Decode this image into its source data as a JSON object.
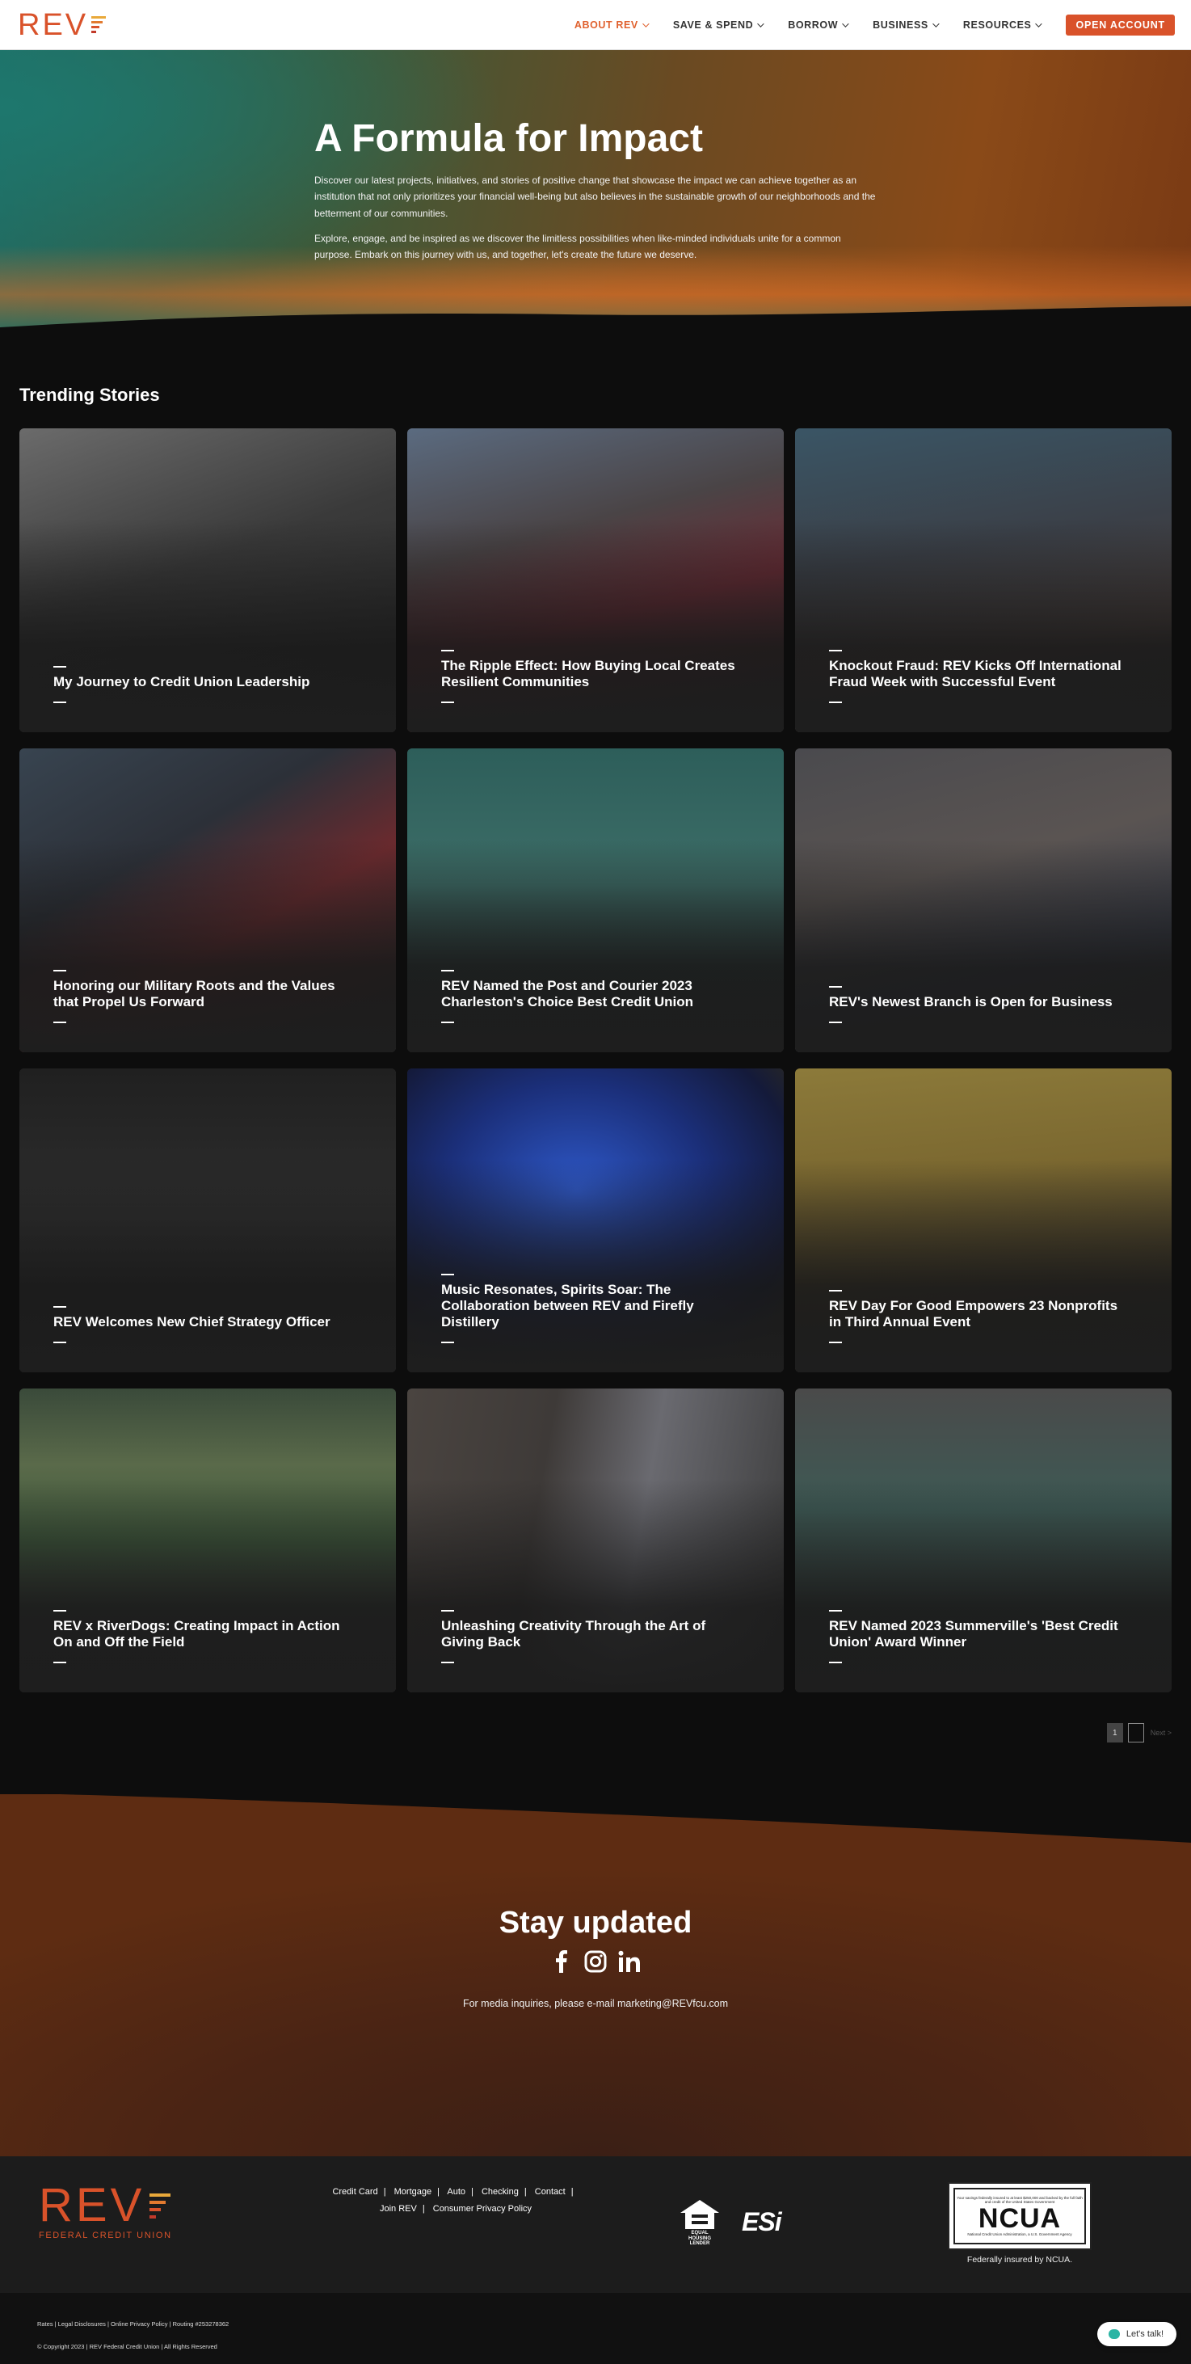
{
  "header": {
    "logo_text": "REV",
    "logo_colors": [
      "#e9a93a",
      "#e27a2f",
      "#d9522a",
      "#c23a2a"
    ],
    "nav": [
      {
        "label": "ABOUT REV",
        "active": true
      },
      {
        "label": "SAVE & SPEND",
        "active": false
      },
      {
        "label": "BORROW",
        "active": false
      },
      {
        "label": "BUSINESS",
        "active": false
      },
      {
        "label": "RESOURCES",
        "active": false
      }
    ],
    "cta": "OPEN ACCOUNT",
    "accent": "#d9522a"
  },
  "hero": {
    "title": "A Formula for Impact",
    "p1": "Discover our latest projects, initiatives, and stories of positive change that showcase the impact we can achieve together as an institution that not only prioritizes your financial well-being but also believes in the sustainable growth of our neighborhoods and the betterment of our communities.",
    "p2": "Explore, engage, and be inspired as we discover the limitless possibilities when like-minded individuals unite for a common purpose. Embark on this journey with us, and together, let's create the future we deserve."
  },
  "trending": {
    "title": "Trending Stories",
    "cards": [
      {
        "title": "My Journey to Credit Union Leadership",
        "bg": "linear-gradient(160deg,#6b6b6b 0%,#3a3a3a 45%,#262626 100%)"
      },
      {
        "title": "The Ripple Effect: How Buying Local Creates Resilient Communities",
        "bg": "linear-gradient(165deg,#5b6b80 0%,#4a4446 35%,#6b2a34 60%,#2b2b2b 100%)"
      },
      {
        "title": "Knockout Fraud: REV Kicks Off International Fraud Week with Successful Event",
        "bg": "linear-gradient(170deg,#3a5565 0%,#3b4048 40%,#4a3f3c 70%,#2a2a2a 100%)"
      },
      {
        "title": "Honoring our Military Roots and the Values that Propel Us Forward",
        "bg": "linear-gradient(150deg,#384450 0%,#2c3038 35%,#6b2a2e 60%,#2b2b2b 100%)"
      },
      {
        "title": "REV Named the Post and Courier 2023 Charleston's Choice Best Credit Union",
        "bg": "linear-gradient(180deg,#2d5e5a 0%,#3d6e68 45%,#2e3a3a 80%,#262626 100%)"
      },
      {
        "title": "REV's Newest Branch is Open for Business",
        "bg": "linear-gradient(165deg,#4a4a4e 0%,#5a5452 40%,#3a3e4a 70%,#262626 100%)"
      },
      {
        "title": "REV Welcomes New Chief Strategy Officer",
        "bg": "linear-gradient(180deg,#202020 0%,#2e2e2e 50%,#2b2b2b 100%)"
      },
      {
        "title": "Music Resonates, Spirits Soar: The Collaboration between REV and Firefly Distillery",
        "bg": "radial-gradient(ellipse 70% 70% at 45% 40%,#2e58c8 0%,#1b2f7a 50%,#141a3a 85%,#262626 100%)"
      },
      {
        "title": "REV Day For Good Empowers 23 Nonprofits in Third Annual Event",
        "bg": "linear-gradient(175deg,#8c7a3a 0%,#7b6830 35%,#4a402a 70%,#262626 100%)"
      },
      {
        "title": "REV x RiverDogs: Creating Impact in Action On and Off the Field",
        "bg": "linear-gradient(180deg,#3a4a3a 0%,#5a6a4a 25%,#3f5a3c 50%,#3a3a3a 80%,#262626 100%)"
      },
      {
        "title": "Unleashing Creativity Through the Art of Giving Back",
        "bg": "linear-gradient(100deg,#4a4440 0%,#3e3a38 35%,#6a6a70 60%,#3a3a3a 100%)"
      },
      {
        "title": "REV Named 2023 Summerville's 'Best Credit Union' Award Winner",
        "bg": "linear-gradient(180deg,#4a4a4a 0%,#3e5a55 40%,#3a4a46 65%,#262626 100%)"
      }
    ],
    "pagination": {
      "current": "1",
      "next": "2",
      "next_label": "Next >"
    }
  },
  "stay": {
    "title": "Stay updated",
    "social": [
      "facebook-icon",
      "instagram-icon",
      "linkedin-icon"
    ],
    "note": "For media inquiries, please e-mail marketing@REVfcu.com"
  },
  "footer": {
    "logo_text": "REV",
    "logo_sub": "FEDERAL CREDIT UNION",
    "links_row1": [
      "Credit Card",
      "Mortgage",
      "Auto",
      "Checking",
      "Contact"
    ],
    "links_row2": [
      "Join REV",
      "Consumer Privacy Policy"
    ],
    "ehl_label": "EQUAL HOUSING LENDER",
    "esi_label": "ESi",
    "ncua_small": "Your savings federally insured to at least $250,000 and backed by the full faith and credit of the United States Government",
    "ncua_big": "NCUA",
    "ncua_bottom": "National Credit Union Administration, a U.S. Government Agency",
    "ncua_caption": "Federally insured by NCUA.",
    "bottom_line1": "Rates  |  Legal Disclosures  |  Online Privacy Policy  |  Routing #253278362",
    "bottom_line2": "© Copyright 2023  |  REV Federal Credit Union  |  All Rights Reserved",
    "chat_label": "Let's talk!"
  }
}
